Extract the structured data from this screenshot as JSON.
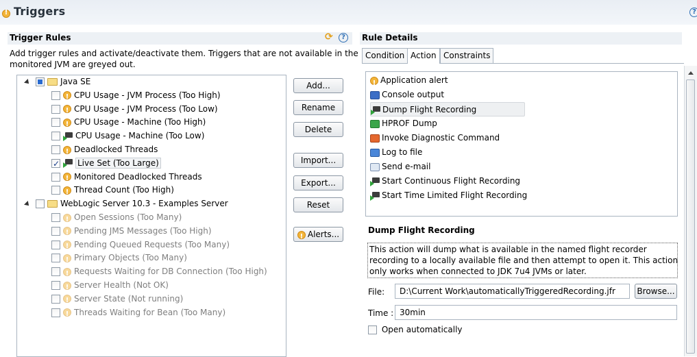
{
  "header": {
    "title": "Triggers"
  },
  "trigger_rules": {
    "title": "Trigger Rules",
    "description_line1": "Add trigger rules and activate/deactivate them. Triggers that are not available in the",
    "description_line2": "monitored JVM are greyed out.",
    "groups": [
      {
        "label": "Java SE",
        "state": "partial",
        "items": [
          {
            "label": "CPU Usage - JVM Process (Too High)",
            "icon": "warning-icon",
            "checked": false,
            "disabled": false
          },
          {
            "label": "CPU Usage - JVM Process (Too Low)",
            "icon": "warning-icon",
            "checked": false,
            "disabled": false
          },
          {
            "label": "CPU Usage - Machine (Too High)",
            "icon": "warning-icon",
            "checked": false,
            "disabled": false
          },
          {
            "label": "CPU Usage - Machine (Too Low)",
            "icon": "flight-recording-icon",
            "checked": false,
            "disabled": false
          },
          {
            "label": "Deadlocked Threads",
            "icon": "warning-icon",
            "checked": false,
            "disabled": false
          },
          {
            "label": "Live Set (Too Large)",
            "icon": "flight-recording-icon",
            "checked": true,
            "disabled": false,
            "selected": true
          },
          {
            "label": "Monitored Deadlocked Threads",
            "icon": "warning-icon",
            "checked": false,
            "disabled": false
          },
          {
            "label": "Thread Count (Too High)",
            "icon": "warning-icon",
            "checked": false,
            "disabled": false
          }
        ]
      },
      {
        "label": "WebLogic Server 10.3 - Examples Server",
        "state": "unchecked",
        "items": [
          {
            "label": "Open Sessions (Too Many)",
            "icon": "warning-icon",
            "checked": false,
            "disabled": true
          },
          {
            "label": "Pending JMS Messages (Too High)",
            "icon": "warning-icon",
            "checked": false,
            "disabled": true
          },
          {
            "label": "Pending Queued Requests (Too Many)",
            "icon": "warning-icon",
            "checked": false,
            "disabled": true
          },
          {
            "label": "Primary Objects (Too Many)",
            "icon": "warning-icon",
            "checked": false,
            "disabled": true
          },
          {
            "label": "Requests Waiting for DB Connection (Too High)",
            "icon": "warning-icon",
            "checked": false,
            "disabled": true
          },
          {
            "label": "Server Health (Not OK)",
            "icon": "warning-icon",
            "checked": false,
            "disabled": true
          },
          {
            "label": "Server State (Not running)",
            "icon": "warning-icon",
            "checked": false,
            "disabled": true
          },
          {
            "label": "Threads Waiting for Bean (Too Many)",
            "icon": "warning-icon",
            "checked": false,
            "disabled": true
          }
        ]
      }
    ],
    "buttons": {
      "add": "Add...",
      "rename": "Rename",
      "delete": "Delete",
      "import": "Import...",
      "export": "Export...",
      "reset": "Reset",
      "alerts": "Alerts..."
    }
  },
  "rule_details": {
    "title": "Rule Details",
    "tabs": [
      "Condition",
      "Action",
      "Constraints"
    ],
    "active_tab": "Action",
    "actions": [
      {
        "label": "Application alert",
        "icon": "warning-icon"
      },
      {
        "label": "Console output",
        "icon": "console-icon"
      },
      {
        "label": "Dump Flight Recording",
        "icon": "flight-recording-icon",
        "selected": true
      },
      {
        "label": "HPROF Dump",
        "icon": "hprof-icon"
      },
      {
        "label": "Invoke Diagnostic Command",
        "icon": "diagnostic-icon"
      },
      {
        "label": "Log to file",
        "icon": "log-icon"
      },
      {
        "label": "Send e-mail",
        "icon": "mail-icon"
      },
      {
        "label": "Start Continuous Flight Recording",
        "icon": "flight-recording-icon"
      },
      {
        "label": "Start Time Limited Flight Recording",
        "icon": "flight-recording-icon"
      }
    ],
    "detail_title": "Dump Flight Recording",
    "detail_description_lines": [
      "This action will dump what is available in the named flight recorder",
      "recording to a locally available file and then attempt to open it. This action",
      "only works when connected to JDK 7u4 JVMs or later."
    ],
    "file_label": "File:",
    "file_value": "D:\\Current Work\\automaticallyTriggeredRecording.jfr",
    "browse_label": "Browse...",
    "time_label": "Time :",
    "time_value": "30min",
    "open_auto_label": "Open automatically",
    "open_auto_checked": false
  }
}
